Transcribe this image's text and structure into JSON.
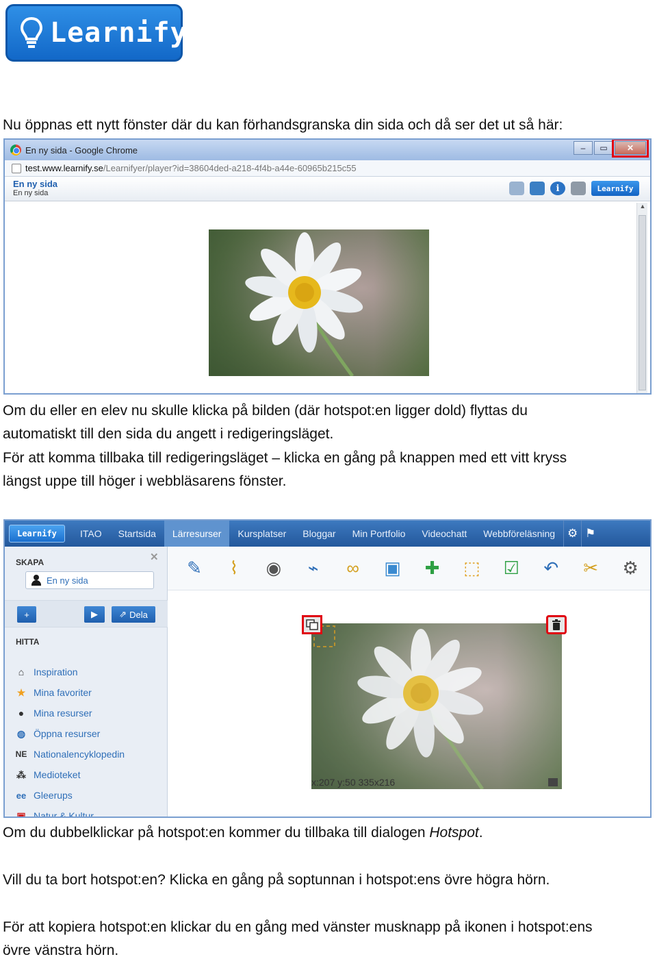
{
  "logo": {
    "text": "Learnify"
  },
  "paragraphs": {
    "p1": "Nu öppnas ett nytt fönster där du kan förhandsgranska din sida och då ser det ut så här:",
    "p2a": "Om du eller en elev nu skulle klicka på bilden (där hotspot:en ligger dold) flyttas du",
    "p2b": "automatiskt till den sida du angett i redigeringsläget.",
    "p3a": "För att komma tillbaka till redigeringsläget – klicka en gång på knappen med ett vitt kryss",
    "p3b": "längst uppe till höger i webbläsarens fönster.",
    "p4_pre": "Om du dubbelklickar på hotspot:en kommer du tillbaka till dialogen ",
    "p4_em": "Hotspot",
    "p4_post": ".",
    "p5": "Vill du ta bort hotspot:en? Klicka en gång på soptunnan i hotspot:ens övre högra hörn.",
    "p6a": "För att kopiera hotspot:en klickar du en gång med vänster musknapp på ikonen i hotspot:ens",
    "p6b": "övre vänstra hörn."
  },
  "browser": {
    "title": "En ny sida - Google Chrome",
    "url_host": "test.www.learnify.se",
    "url_rest": "/Learnifyer/player?id=38604ded-a218-4f4b-a44e-60965b215c55",
    "page_title": "En ny sida",
    "page_subtitle": "En ny sida",
    "brand_button": "Learnify",
    "info_glyph": "i"
  },
  "app": {
    "brand": "Learnify",
    "nav": [
      "ITAO",
      "Startsida",
      "Lärresurser",
      "Kursplatser",
      "Bloggar",
      "Min Portfolio",
      "Videochatt",
      "Webbföreläsning"
    ],
    "active_nav_index": 2,
    "skapa_label": "SKAPA",
    "new_page": "En ny sida",
    "add_label": "+",
    "play_label": "▶",
    "share_label": "Dela",
    "hitta_label": "HITTA",
    "side_items": [
      {
        "icon": "home-icon",
        "glyph": "⌂",
        "label": "Inspiration"
      },
      {
        "icon": "star-icon",
        "glyph": "★",
        "label": "Mina favoriter"
      },
      {
        "icon": "person-icon",
        "glyph": "●",
        "label": "Mina resurser"
      },
      {
        "icon": "globe-icon",
        "glyph": "◍",
        "label": "Öppna resurser"
      },
      {
        "icon": "ne-icon",
        "glyph": "NE",
        "label": "Nationalencyklopedin"
      },
      {
        "icon": "network-icon",
        "glyph": "⁂",
        "label": "Medioteket"
      },
      {
        "icon": "gleerups-icon",
        "glyph": "ee",
        "label": "Gleerups"
      },
      {
        "icon": "nk-icon",
        "glyph": "▣",
        "label": "Natur & Kultur"
      }
    ],
    "coords": "x:207 y:50 335x216"
  },
  "colors": {
    "accent": "#2f6fb8",
    "highlight": "#e00010",
    "nav_bg": "#2a63a8"
  }
}
